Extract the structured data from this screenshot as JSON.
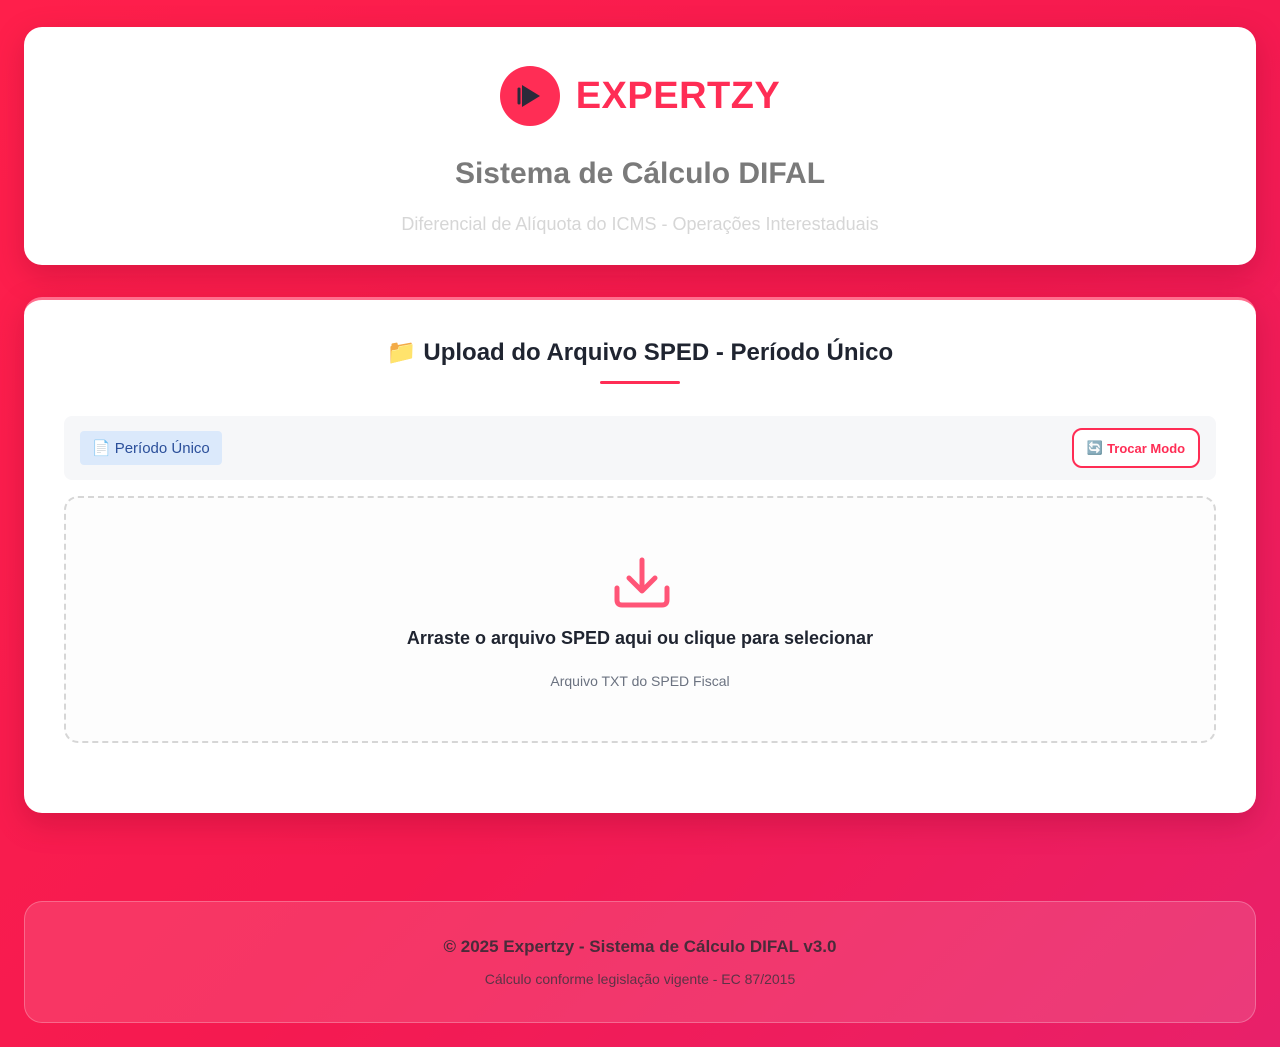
{
  "header": {
    "brand": "EXPERTZY",
    "title": "Sistema de Cálculo DIFAL",
    "subtitle": "Diferencial de Alíquota do ICMS - Operações Interestaduais"
  },
  "upload": {
    "title_icon": "📁",
    "title": "Upload do Arquivo SPED - Período Único",
    "mode_icon": "📄",
    "mode_label": "Período Único",
    "switch_icon": "🔄",
    "switch_label": "Trocar Modo",
    "dropzone_text": "Arraste o arquivo SPED aqui ou clique para selecionar",
    "dropzone_hint": "Arquivo TXT do SPED Fiscal"
  },
  "footer": {
    "main": "© 2025 Expertzy - Sistema de Cálculo DIFAL v3.0",
    "sub": "Cálculo conforme legislação vigente - EC 87/2015"
  },
  "colors": {
    "accent": "#ff2d55",
    "background": "#ff1f4b"
  },
  "icons": {
    "logo": "play-logo-icon",
    "dropzone": "download-icon"
  }
}
